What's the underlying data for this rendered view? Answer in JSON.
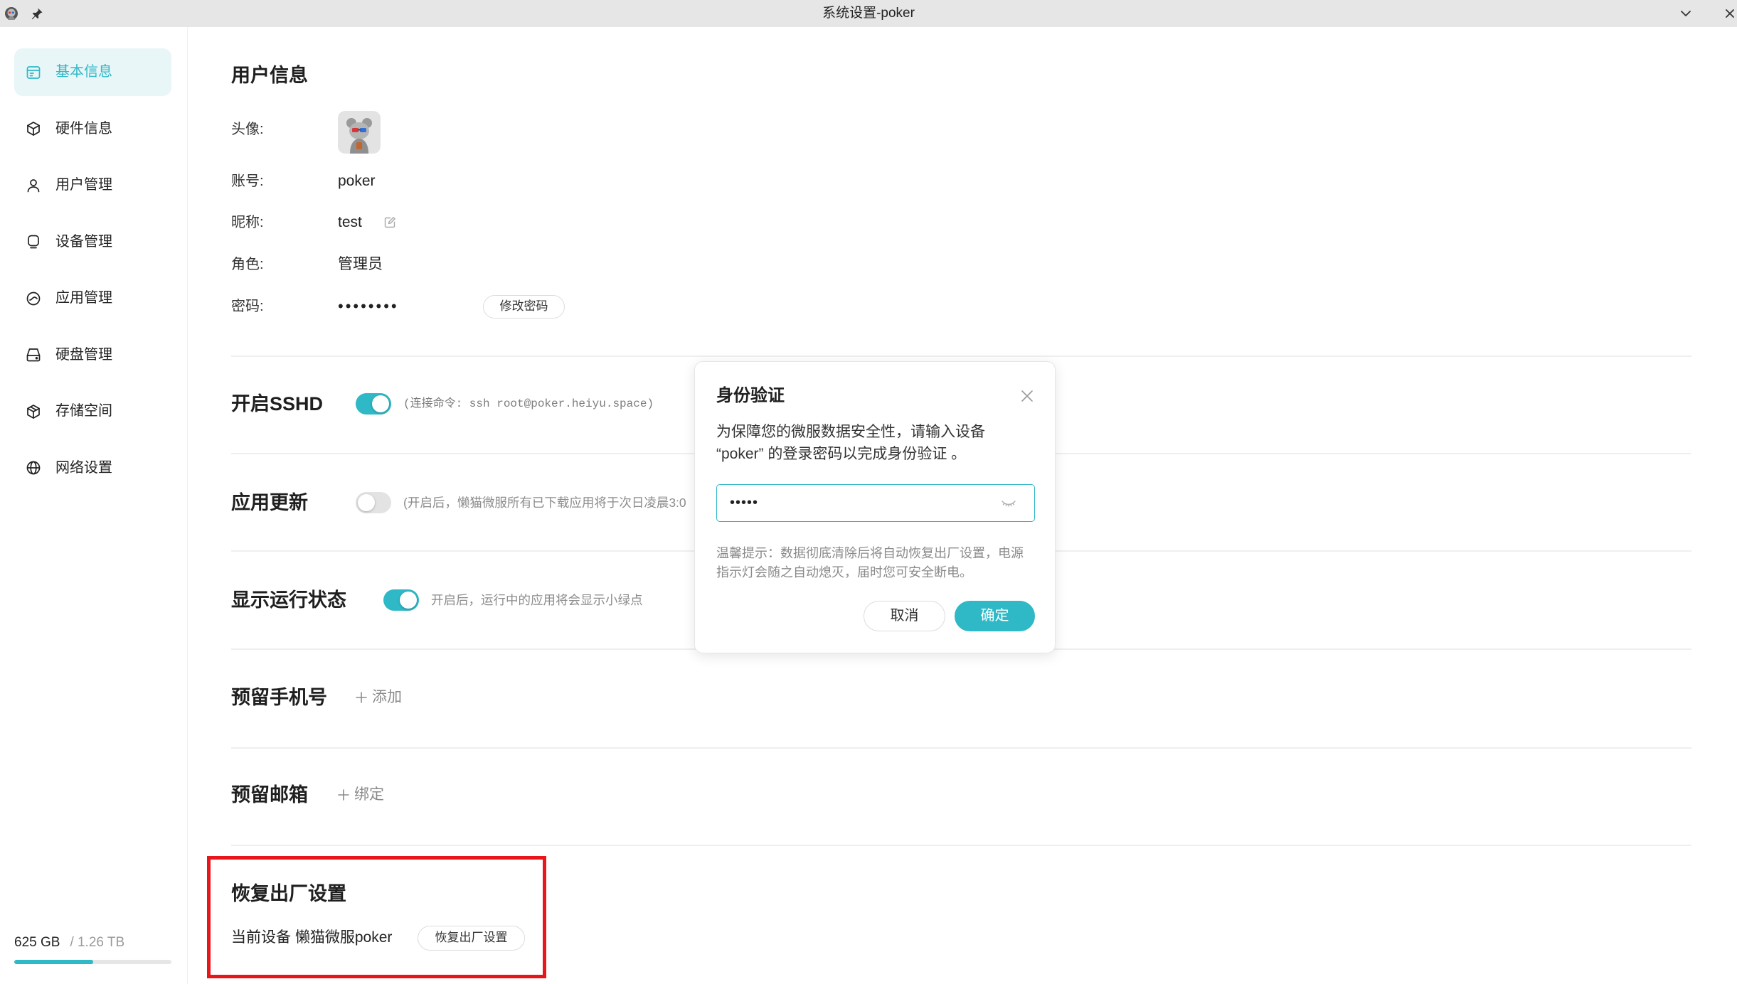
{
  "theme": {
    "accent": "#2fb8c6",
    "accent_light": "#e8f6f8",
    "highlight_border": "#e8161b"
  },
  "window": {
    "title": "系统设置-poker",
    "icons": [
      "app-logo-icon",
      "pin-icon",
      "chevron-down-icon",
      "close-icon"
    ]
  },
  "sidebar": {
    "items": [
      {
        "label": "基本信息",
        "icon": "info-card-icon",
        "selected": true
      },
      {
        "label": "硬件信息",
        "icon": "cube-icon",
        "selected": false
      },
      {
        "label": "用户管理",
        "icon": "user-icon",
        "selected": false
      },
      {
        "label": "设备管理",
        "icon": "device-icon",
        "selected": false
      },
      {
        "label": "应用管理",
        "icon": "app-icon",
        "selected": false
      },
      {
        "label": "硬盘管理",
        "icon": "disk-icon",
        "selected": false
      },
      {
        "label": "存储空间",
        "icon": "storage-box-icon",
        "selected": false
      },
      {
        "label": "网络设置",
        "icon": "globe-icon",
        "selected": false
      }
    ],
    "storage": {
      "used": "625 GB",
      "total": "/ 1.26 TB",
      "used_fraction": 0.5
    }
  },
  "user_info": {
    "title": "用户信息",
    "avatar_label": "头像:",
    "account_label": "账号:",
    "account_value": "poker",
    "nickname_label": "昵称:",
    "nickname_value": "test",
    "role_label": "角色:",
    "role_value": "管理员",
    "password_label": "密码:",
    "password_mask": "••••••••",
    "change_password_label": "修改密码"
  },
  "settings": {
    "sshd": {
      "title": "开启SSHD",
      "enabled": true,
      "hint": "(连接命令: ssh root@poker.heiyu.space)"
    },
    "app_update": {
      "title": "应用更新",
      "enabled": false,
      "hint": "(开启后，懒猫微服所有已下载应用将于次日凌晨3:0"
    },
    "running_status": {
      "title": "显示运行状态",
      "enabled": true,
      "hint": "开启后，运行中的应用将会显示小绿点"
    },
    "phone": {
      "title": "预留手机号",
      "action_label": "添加",
      "action_icon": "plus-icon"
    },
    "email": {
      "title": "预留邮箱",
      "action_label": "绑定",
      "action_icon": "plus-icon"
    }
  },
  "factory_reset": {
    "title": "恢复出厂设置",
    "device_label": "当前设备 懒猫微服poker",
    "button_label": "恢复出厂设置"
  },
  "dialog": {
    "title": "身份验证",
    "message_lines": [
      "为保障您的微服数据安全性，请输入设备",
      "“poker” 的登录密码以完成身份验证 。"
    ],
    "password_value": "•••••",
    "hint_lines": [
      "温馨提示：数据彻底清除后将自动恢复出厂设置，电源",
      "指示灯会随之自动熄灭，届时您可安全断电。"
    ],
    "cancel_label": "取消",
    "confirm_label": "确定"
  }
}
